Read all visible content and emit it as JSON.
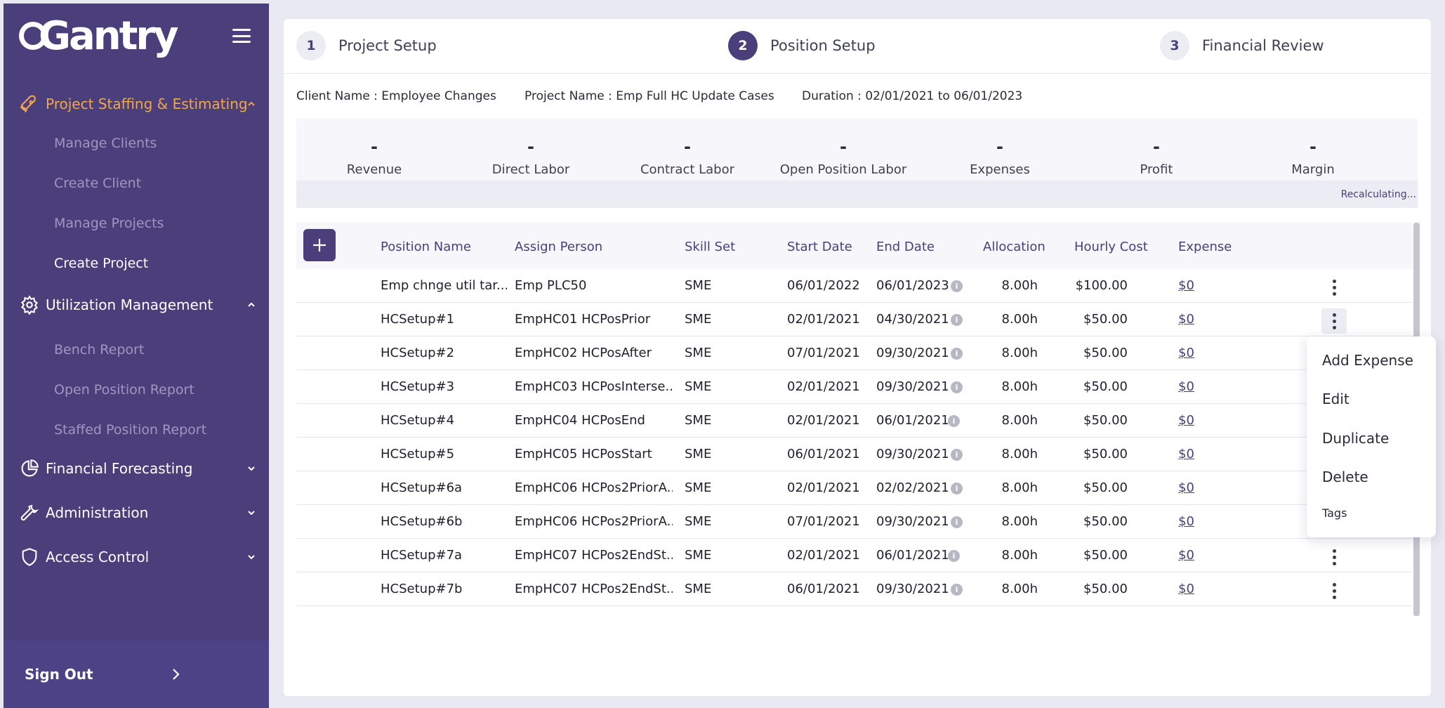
{
  "app": {
    "logo_text": "Gantry"
  },
  "sidebar": {
    "sections": [
      {
        "label": "Project Staffing & Estimating",
        "active": true,
        "expanded": true,
        "icon": "rocket-icon"
      },
      {
        "label": "Utilization Management",
        "expanded": true,
        "icon": "gear-icon"
      },
      {
        "label": "Financial Forecasting",
        "expanded": false,
        "icon": "pie-chart-icon"
      },
      {
        "label": "Administration",
        "expanded": false,
        "icon": "wrench-icon"
      },
      {
        "label": "Access Control",
        "expanded": false,
        "icon": "shield-icon"
      }
    ],
    "staffing_items": [
      "Manage Clients",
      "Create Client",
      "Manage Projects",
      "Create Project"
    ],
    "utilization_items": [
      "Bench Report",
      "Open Position Report",
      "Staffed Position Report"
    ],
    "sign_out": "Sign Out"
  },
  "stepper": [
    {
      "num": "1",
      "label": "Project Setup"
    },
    {
      "num": "2",
      "label": "Position Setup",
      "active": true
    },
    {
      "num": "3",
      "label": "Financial Review"
    }
  ],
  "project_info": {
    "client": "Client Name : Employee Changes",
    "project": "Project Name : Emp Full HC Update Cases",
    "duration": "Duration : 02/01/2021 to 06/01/2023"
  },
  "summary": {
    "metrics": [
      {
        "label": "Revenue",
        "value": "-"
      },
      {
        "label": "Direct Labor",
        "value": "-"
      },
      {
        "label": "Contract Labor",
        "value": "-"
      },
      {
        "label": "Open Position Labor",
        "value": "-"
      },
      {
        "label": "Expenses",
        "value": "-"
      },
      {
        "label": "Profit",
        "value": "-"
      },
      {
        "label": "Margin",
        "value": "-"
      }
    ],
    "status": "Recalculating..."
  },
  "table": {
    "headers": [
      "Position Name",
      "Assign Person",
      "Skill Set",
      "Start Date",
      "End Date",
      "Allocation",
      "Hourly Cost",
      "Expense"
    ],
    "rows": [
      {
        "position": "Emp chnge util tar...",
        "person": "Emp PLC50",
        "skill": "SME",
        "start": "06/01/2022",
        "end": "06/01/2023",
        "allocation": "8.00h",
        "cost": "$100.00",
        "expense": "$0"
      },
      {
        "position": "HCSetup#1",
        "person": "EmpHC01 HCPosPrior",
        "skill": "SME",
        "start": "02/01/2021",
        "end": "04/30/2021",
        "allocation": "8.00h",
        "cost": "$50.00",
        "expense": "$0"
      },
      {
        "position": "HCSetup#2",
        "person": "EmpHC02 HCPosAfter",
        "skill": "SME",
        "start": "07/01/2021",
        "end": "09/30/2021",
        "allocation": "8.00h",
        "cost": "$50.00",
        "expense": "$0"
      },
      {
        "position": "HCSetup#3",
        "person": "EmpHC03 HCPosInterse...",
        "skill": "SME",
        "start": "02/01/2021",
        "end": "09/30/2021",
        "allocation": "8.00h",
        "cost": "$50.00",
        "expense": "$0"
      },
      {
        "position": "HCSetup#4",
        "person": "EmpHC04 HCPosEnd",
        "skill": "SME",
        "start": "02/01/2021",
        "end": "06/01/2021",
        "allocation": "8.00h",
        "cost": "$50.00",
        "expense": "$0"
      },
      {
        "position": "HCSetup#5",
        "person": "EmpHC05 HCPosStart",
        "skill": "SME",
        "start": "06/01/2021",
        "end": "09/30/2021",
        "allocation": "8.00h",
        "cost": "$50.00",
        "expense": "$0"
      },
      {
        "position": "HCSetup#6a",
        "person": "EmpHC06 HCPos2PriorA...",
        "skill": "SME",
        "start": "02/01/2021",
        "end": "02/02/2021",
        "allocation": "8.00h",
        "cost": "$50.00",
        "expense": "$0"
      },
      {
        "position": "HCSetup#6b",
        "person": "EmpHC06 HCPos2PriorA...",
        "skill": "SME",
        "start": "07/01/2021",
        "end": "09/30/2021",
        "allocation": "8.00h",
        "cost": "$50.00",
        "expense": "$0"
      },
      {
        "position": "HCSetup#7a",
        "person": "EmpHC07 HCPos2EndSt...",
        "skill": "SME",
        "start": "02/01/2021",
        "end": "06/01/2021",
        "allocation": "8.00h",
        "cost": "$50.00",
        "expense": "$0"
      },
      {
        "position": "HCSetup#7b",
        "person": "EmpHC07 HCPos2EndSt...",
        "skill": "SME",
        "start": "06/01/2021",
        "end": "09/30/2021",
        "allocation": "8.00h",
        "cost": "$50.00",
        "expense": "$0"
      }
    ]
  },
  "row_menu": {
    "items": [
      "Add Expense",
      "Edit",
      "Duplicate",
      "Delete",
      "Tags"
    ]
  },
  "colors": {
    "sidebar": "#4a3f7a",
    "accent": "#f1a64e",
    "primary": "#4a3f7a"
  }
}
